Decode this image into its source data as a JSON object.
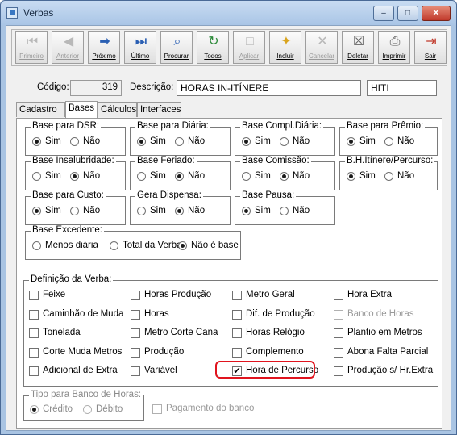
{
  "window": {
    "title": "Verbas"
  },
  "toolbar": [
    {
      "label": "Primeiro",
      "icon": "first-icon",
      "disabled": true
    },
    {
      "label": "Anterior",
      "icon": "previous-icon",
      "disabled": true
    },
    {
      "label": "Próximo",
      "icon": "next-icon",
      "disabled": false
    },
    {
      "label": "Último",
      "icon": "last-icon",
      "disabled": false
    },
    {
      "label": "Procurar",
      "icon": "search-icon",
      "disabled": false
    },
    {
      "label": "Todos",
      "icon": "refresh-icon",
      "disabled": false
    },
    {
      "label": "Aplicar",
      "icon": "apply-icon",
      "disabled": true
    },
    {
      "label": "Incluir",
      "icon": "new-icon",
      "disabled": false
    },
    {
      "label": "Cancelar",
      "icon": "cancel-icon",
      "disabled": true
    },
    {
      "label": "Deletar",
      "icon": "trash-icon",
      "disabled": false
    },
    {
      "label": "Imprimir",
      "icon": "printer-icon",
      "disabled": false
    },
    {
      "label": "Sair",
      "icon": "exit-icon",
      "disabled": false
    }
  ],
  "form": {
    "codigo_label": "Código:",
    "codigo": "319",
    "descricao_label": "Descrição:",
    "descricao": "HORAS IN-ITÍNERE",
    "abreviacao": "HITI"
  },
  "tabs": [
    "Cadastro",
    "Bases",
    "Cálculos",
    "Interfaces"
  ],
  "active_tab": "Bases",
  "bases": [
    {
      "title": "Base para DSR:",
      "options": [
        "Sim",
        "Não"
      ],
      "selected": "Sim"
    },
    {
      "title": "Base para Diária:",
      "options": [
        "Sim",
        "Não"
      ],
      "selected": "Sim"
    },
    {
      "title": "Base Compl.Diária:",
      "options": [
        "Sim",
        "Não"
      ],
      "selected": "Sim"
    },
    {
      "title": "Base para Prêmio:",
      "options": [
        "Sim",
        "Não"
      ],
      "selected": "Sim"
    },
    {
      "title": "Base Insalubridade:",
      "options": [
        "Sim",
        "Não"
      ],
      "selected": "Não"
    },
    {
      "title": "Base Feriado:",
      "options": [
        "Sim",
        "Não"
      ],
      "selected": "Não"
    },
    {
      "title": "Base Comissão:",
      "options": [
        "Sim",
        "Não"
      ],
      "selected": "Não"
    },
    {
      "title": "B.H.Itínere/Percurso:",
      "options": [
        "Sim",
        "Não"
      ],
      "selected": "Sim"
    },
    {
      "title": "Base para Custo:",
      "options": [
        "Sim",
        "Não"
      ],
      "selected": "Sim"
    },
    {
      "title": "Gera Dispensa:",
      "options": [
        "Sim",
        "Não"
      ],
      "selected": "Não"
    },
    {
      "title": "Base Pausa:",
      "options": [
        "Sim",
        "Não"
      ],
      "selected": "Sim"
    }
  ],
  "excedente": {
    "title": "Base Excedente:",
    "options": [
      "Menos diária",
      "Total da Verba",
      "Não é base"
    ],
    "selected": "Não é base"
  },
  "definicao": {
    "title": "Definição da Verba:",
    "columns": [
      [
        {
          "label": "Feixe",
          "checked": false,
          "disabled": false
        },
        {
          "label": "Caminhão de Muda",
          "checked": false,
          "disabled": false
        },
        {
          "label": "Tonelada",
          "checked": false,
          "disabled": false
        },
        {
          "label": "Corte Muda Metros",
          "checked": false,
          "disabled": false
        },
        {
          "label": "Adicional de Extra",
          "checked": false,
          "disabled": false
        }
      ],
      [
        {
          "label": "Horas Produção",
          "checked": false,
          "disabled": false
        },
        {
          "label": "Horas",
          "checked": false,
          "disabled": false
        },
        {
          "label": "Metro Corte Cana",
          "checked": false,
          "disabled": false
        },
        {
          "label": "Produção",
          "checked": false,
          "disabled": false
        },
        {
          "label": "Variável",
          "checked": false,
          "disabled": false
        }
      ],
      [
        {
          "label": "Metro Geral",
          "checked": false,
          "disabled": false
        },
        {
          "label": "Dif. de Produção",
          "checked": false,
          "disabled": false
        },
        {
          "label": "Horas Relógio",
          "checked": false,
          "disabled": false
        },
        {
          "label": "Complemento",
          "checked": false,
          "disabled": false
        },
        {
          "label": "Hora de Percurso",
          "checked": true,
          "disabled": false
        }
      ],
      [
        {
          "label": "Hora Extra",
          "checked": false,
          "disabled": false
        },
        {
          "label": "Banco de Horas",
          "checked": false,
          "disabled": true
        },
        {
          "label": "Plantio em Metros",
          "checked": false,
          "disabled": false
        },
        {
          "label": "Abona Falta Parcial",
          "checked": false,
          "disabled": false
        },
        {
          "label": "Produção s/ Hr.Extra",
          "checked": false,
          "disabled": false
        }
      ]
    ]
  },
  "banco": {
    "title": "Tipo para Banco de Horas:",
    "options": [
      "Crédito",
      "Débito"
    ],
    "selected": "Crédito",
    "pagamento_label": "Pagamento do banco"
  }
}
